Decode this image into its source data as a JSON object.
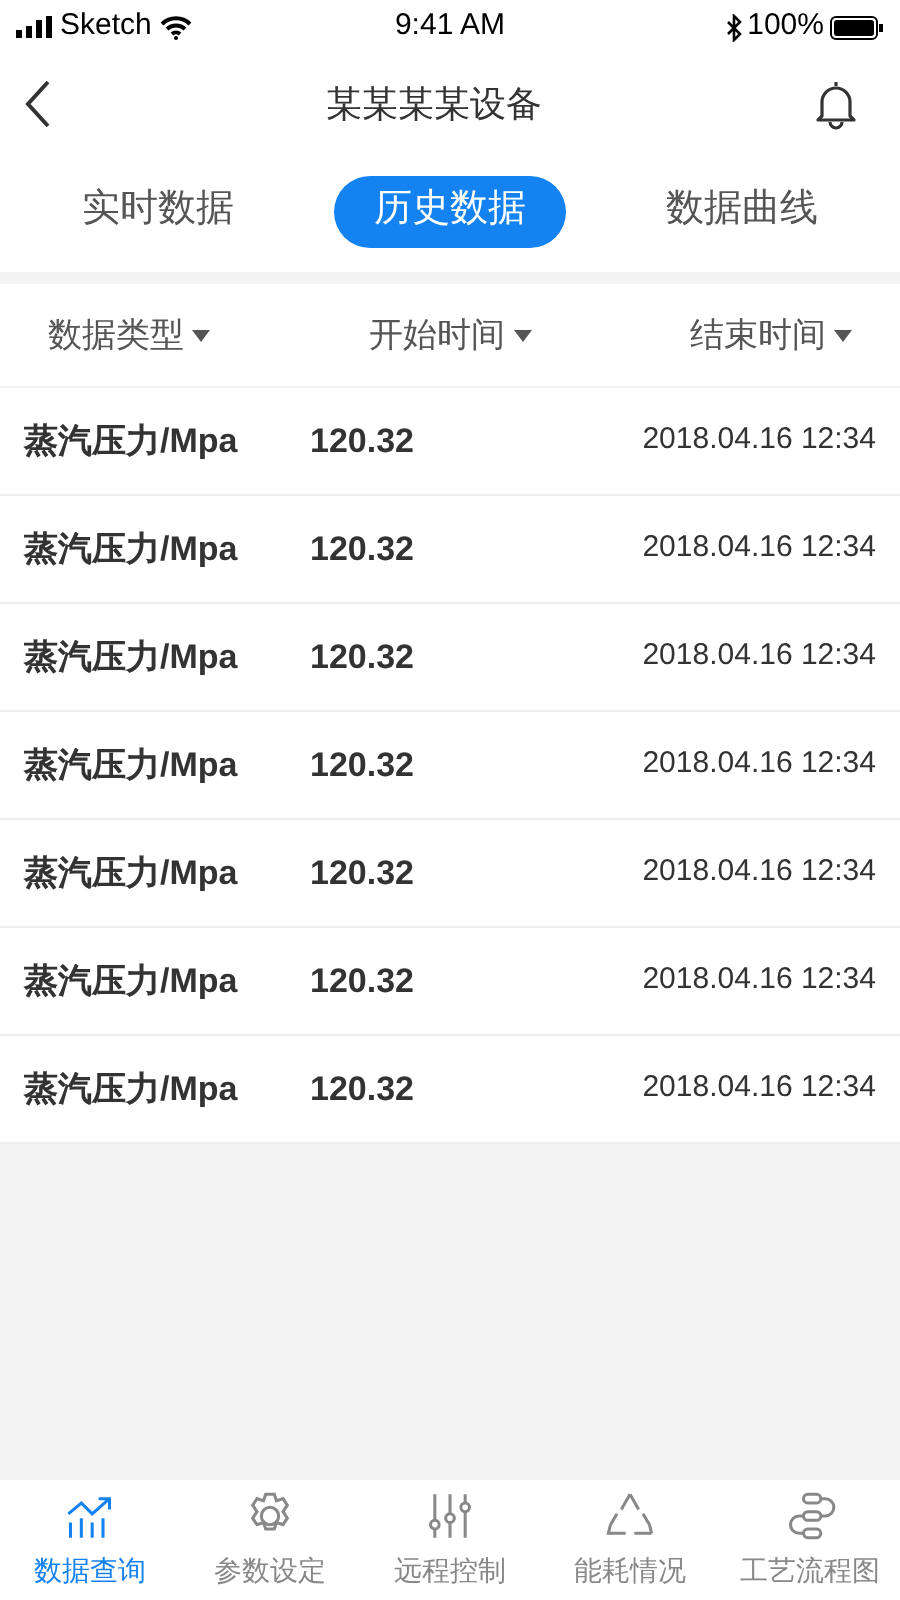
{
  "status_bar": {
    "carrier": "Sketch",
    "time": "9:41 AM",
    "battery": "100%"
  },
  "nav": {
    "title": "某某某某设备"
  },
  "tabs": [
    {
      "label": "实时数据",
      "selected": false
    },
    {
      "label": "历史数据",
      "selected": true
    },
    {
      "label": "数据曲线",
      "selected": false
    }
  ],
  "filters": [
    {
      "label": "数据类型"
    },
    {
      "label": "开始时间"
    },
    {
      "label": "结束时间"
    }
  ],
  "rows": [
    {
      "name": "蒸汽压力/Mpa",
      "value": "120.32",
      "time": "2018.04.16 12:34"
    },
    {
      "name": "蒸汽压力/Mpa",
      "value": "120.32",
      "time": "2018.04.16 12:34"
    },
    {
      "name": "蒸汽压力/Mpa",
      "value": "120.32",
      "time": "2018.04.16 12:34"
    },
    {
      "name": "蒸汽压力/Mpa",
      "value": "120.32",
      "time": "2018.04.16 12:34"
    },
    {
      "name": "蒸汽压力/Mpa",
      "value": "120.32",
      "time": "2018.04.16 12:34"
    },
    {
      "name": "蒸汽压力/Mpa",
      "value": "120.32",
      "time": "2018.04.16 12:34"
    },
    {
      "name": "蒸汽压力/Mpa",
      "value": "120.32",
      "time": "2018.04.16 12:34"
    }
  ],
  "tab_bar": [
    {
      "label": "数据查询",
      "selected": true
    },
    {
      "label": "参数设定",
      "selected": false
    },
    {
      "label": "远程控制",
      "selected": false
    },
    {
      "label": "能耗情况",
      "selected": false
    },
    {
      "label": "工艺流程图",
      "selected": false
    }
  ]
}
